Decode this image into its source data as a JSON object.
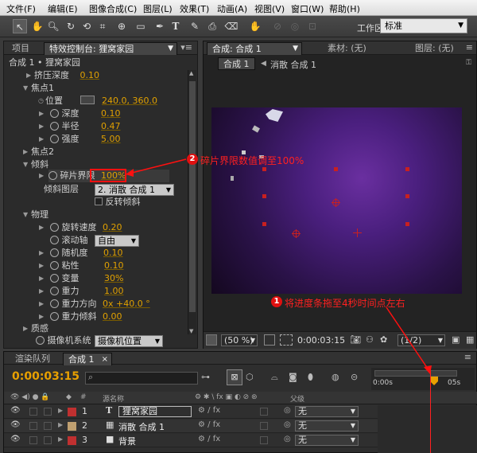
{
  "menu": [
    "文件(F)",
    "编辑(E)",
    "图像合成(C)",
    "图层(L)",
    "效果(T)",
    "动画(A)",
    "视图(V)",
    "窗口(W)",
    "帮助(H)"
  ],
  "toolbar": {
    "workspace_label": "工作区:",
    "workspace_value": "标准"
  },
  "left_panel": {
    "tab_project": "项目",
    "tab_effects": "特效控制台: 狸窝家园",
    "comp_path": "合成 1 • 狸窝家园",
    "props": {
      "squeeze_depth": "挤压深度",
      "squeeze_depth_val": "0.10",
      "focus1": "焦点1",
      "position": "位置",
      "position_val": "240.0, 360.0",
      "depth": "深度",
      "depth_val": "0.10",
      "radius": "半径",
      "radius_val": "0.47",
      "strength": "强度",
      "strength_val": "5.00",
      "focus2": "焦点2",
      "tilt": "倾斜",
      "shatter_threshold": "碎片界限",
      "shatter_threshold_val": "100%",
      "tilt_layer": "倾斜图层",
      "tilt_layer_val": "2. 消散 合成 1",
      "invert_tilt": "反转倾斜",
      "physics": "物理",
      "rotation_speed": "旋转速度",
      "rotation_speed_val": "0.20",
      "tumble_axis": "滚动轴",
      "tumble_axis_val": "自由",
      "randomness": "随机度",
      "randomness_val": "0.10",
      "viscosity": "粘性",
      "viscosity_val": "0.10",
      "mass_variance": "变量",
      "mass_variance_val": "30%",
      "gravity": "重力",
      "gravity_val": "1.00",
      "gravity_direction": "重力方向",
      "gravity_direction_val": "0x +40.0 °",
      "gravity_tilt": "重力倾斜",
      "gravity_tilt_val": "0.00",
      "textures": "质感",
      "camera_system": "摄像机系统",
      "camera_system_val": "摄像机位置"
    }
  },
  "right_panel": {
    "tab_comp": "合成: 合成 1",
    "tab_footage": "素材: (无)",
    "tab_layer": "图层: (无)",
    "sub_tab": "合成 1",
    "breadcrumb": "消散 合成 1",
    "zoom": "(50 %)",
    "timecode": "0:00:03:15",
    "resolution": "(1/2)"
  },
  "timeline": {
    "tab_render": "渲染队列",
    "tab_comp": "合成 1",
    "current_time": "0:00:03:15",
    "header_name": "源名称",
    "header_parent": "父级",
    "ruler_start": "0:00s",
    "ruler_end": "05s",
    "layers": [
      {
        "num": "1",
        "name": "狸窝家园",
        "parent": "无",
        "color": "#c03030",
        "icon": "T"
      },
      {
        "num": "2",
        "name": "消散 合成 1",
        "parent": "无",
        "color": "#c0a070",
        "icon": "comp"
      },
      {
        "num": "3",
        "name": "背景",
        "parent": "无",
        "color": "#c03030",
        "icon": "solid"
      }
    ]
  },
  "annotations": {
    "note1_num": "1",
    "note1": "将进度条拖至4秒时间点左右",
    "note2_num": "2",
    "note2": "碎片界限数值调至100%"
  },
  "colors": {
    "accent_value": "#e0a000",
    "annotation": "#ff2020"
  }
}
